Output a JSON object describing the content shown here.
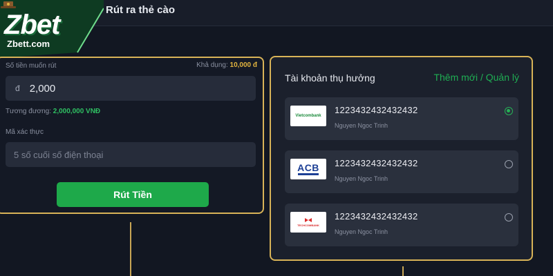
{
  "header": {
    "title": "Rút ra thẻ cào"
  },
  "brand": {
    "logo_text": "Zbet",
    "site": "Zbett.com"
  },
  "withdraw_form": {
    "amount_label": "Số tiền muốn rút",
    "available_label": "Khả dụng:",
    "available_value": "10,000 đ",
    "currency_symbol": "đ",
    "amount_value": "2,000",
    "equivalent_label": "Tương đương:",
    "equivalent_value": "2,000,000 VNĐ",
    "code_label": "Mã xác thực",
    "code_placeholder": "5 số cuối số điện thoại",
    "submit_label": "Rút Tiền"
  },
  "accounts": {
    "title": "Tài khoản thụ hưởng",
    "manage_label": "Thêm mới / Quản lý",
    "items": [
      {
        "bank": "Vietcombank",
        "logo_text": "Vietcombank",
        "number": "1223432432432432",
        "holder": "Nguyen Ngoc Trinh",
        "selected": true
      },
      {
        "bank": "ACB",
        "logo_text": "ACB",
        "number": "1223432432432432",
        "holder": "Nguyen Ngoc Trinh",
        "selected": false
      },
      {
        "bank": "Techcombank",
        "logo_text": "TECHCOMBANK",
        "number": "1223432432432432",
        "holder": "Nguyen Ngoc Trinh",
        "selected": false
      }
    ]
  },
  "colors": {
    "accent_green": "#1ea94a",
    "highlight_gold": "#d9b458",
    "background": "#121722"
  }
}
